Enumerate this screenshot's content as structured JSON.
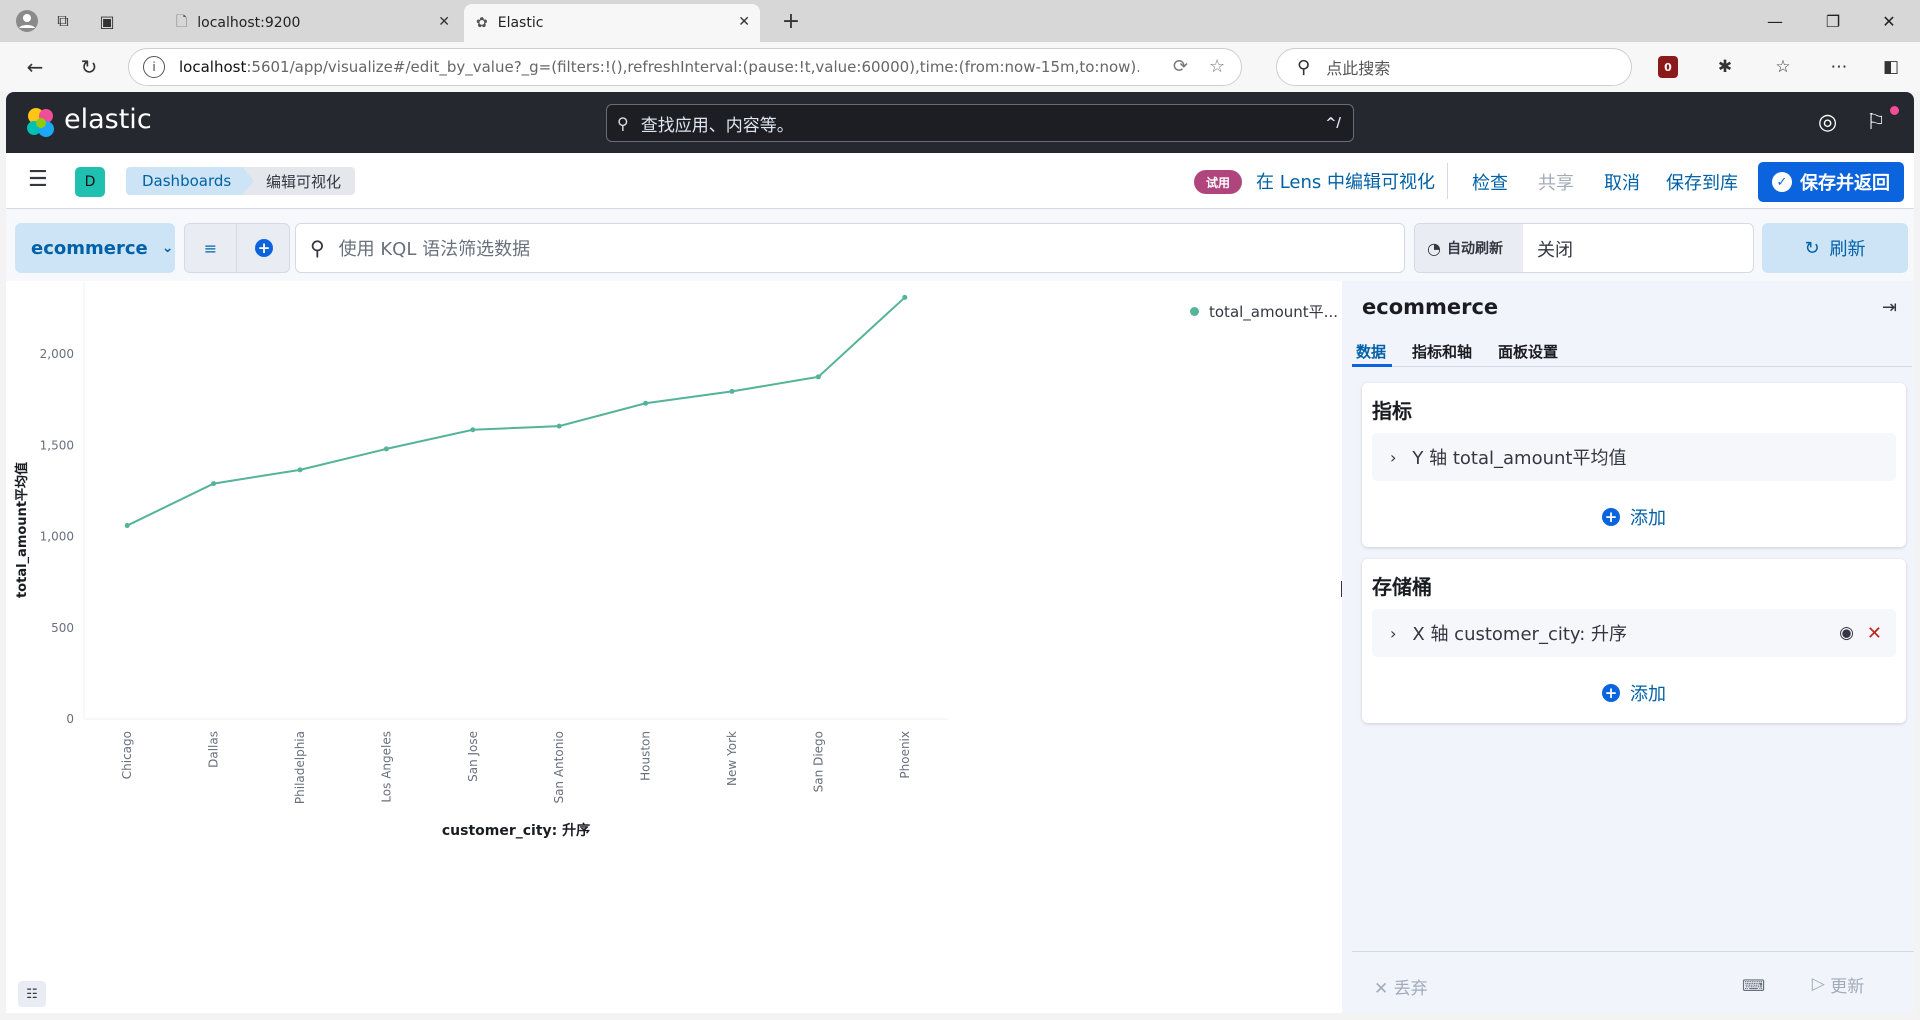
{
  "browser": {
    "tabs": [
      {
        "title": "localhost:9200"
      },
      {
        "title": "Elastic"
      }
    ],
    "url_host": "localhost",
    "url_rest": ":5601/app/visualize#/edit_by_value?_g=(filters:!(),refreshInterval:(pause:!t,value:60000),time:(from:now-15m,to:now)...",
    "search_placeholder": "点此搜索",
    "ext_badge": "0"
  },
  "kibana": {
    "brand": "elastic",
    "search_placeholder": "查找应用、内容等。",
    "search_kbd": "^/"
  },
  "toolbar": {
    "space_initial": "D",
    "breadcrumbs": [
      "Dashboards",
      "编辑可视化"
    ],
    "trial_badge": "试用",
    "lens_link": "在 Lens 中编辑可视化",
    "inspect": "检查",
    "share": "共享",
    "cancel": "取消",
    "save_to_library": "保存到库",
    "save_and_return": "保存并返回"
  },
  "querybar": {
    "dataview": "ecommerce",
    "kql_placeholder": "使用 KQL 语法筛选数据",
    "auto_refresh_label": "自动刷新",
    "auto_refresh_value": "关闭",
    "refresh": "刷新"
  },
  "chart_data": {
    "type": "line",
    "x": [
      "Chicago",
      "Dallas",
      "Philadelphia",
      "Los Angeles",
      "San Jose",
      "San Antonio",
      "Houston",
      "New York",
      "San Diego",
      "Phoenix"
    ],
    "series": [
      {
        "name": "total_amount平...",
        "values": [
          1060,
          1290,
          1365,
          1480,
          1585,
          1605,
          1730,
          1795,
          1875,
          2310
        ]
      }
    ],
    "xlabel": "customer_city: 升序",
    "ylabel": "total_amount平均值",
    "yticks": [
      "0",
      "500",
      "1,000",
      "1,500",
      "2,000"
    ],
    "ylim": [
      0,
      2400
    ],
    "color": "#54b399",
    "legend_position": "top-right"
  },
  "config": {
    "title": "ecommerce",
    "tabs": [
      "数据",
      "指标和轴",
      "面板设置"
    ],
    "metrics_title": "指标",
    "metric_item": "Y 轴 total_amount平均值",
    "buckets_title": "存储桶",
    "bucket_item": "X 轴 customer_city: 升序",
    "add_label": "添加",
    "discard": "丢弃",
    "update": "更新"
  }
}
